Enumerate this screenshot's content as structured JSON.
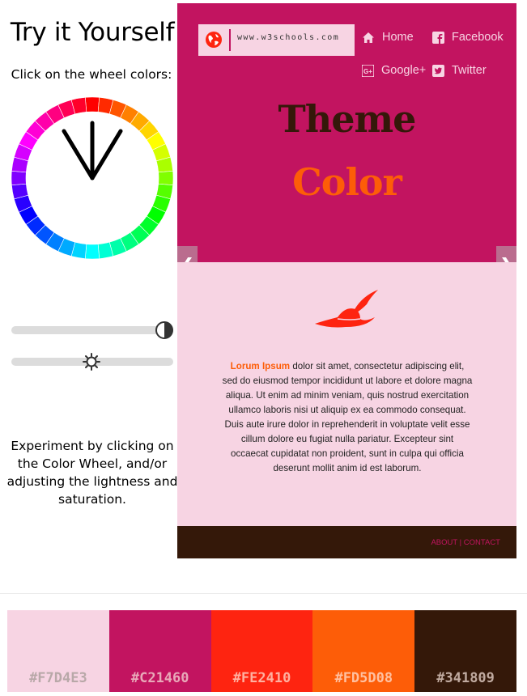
{
  "left": {
    "title": "Try it Yourself",
    "subtitle": "Click on the wheel colors:",
    "experiment_text": "Experiment by clicking on the Color Wheel, and/or adjusting the lightness and saturation.",
    "lightness_icon": "contrast-icon",
    "saturation_icon": "brightness-icon"
  },
  "preview": {
    "logo_text": "www.w3schools.com",
    "nav": {
      "home": "Home",
      "facebook": "Facebook",
      "googleplus": "Google+",
      "twitter": "Twitter"
    },
    "title_line1": "Theme",
    "title_line2": "Color",
    "prev_arrow": "❮",
    "next_arrow": "❯",
    "lorem_highlight": "Lorum Ipsum",
    "lorem_body": " dolor sit amet, consectetur adipiscing elit, sed do eiusmod tempor incididunt ut labore et dolore magna aliqua. Ut enim ad minim veniam, quis nostrud exercitation ullamco laboris nisi ut aliquip ex ea commodo consequat. Duis aute irure dolor in reprehenderit in voluptate velit esse cillum dolore eu fugiat nulla pariatur. Excepteur sint occaecat cupidatat non proident, sunt in culpa qui officia deserunt mollit anim id est laborum.",
    "footer_about": "ABOUT",
    "footer_sep": " | ",
    "footer_contact": "CONTACT"
  },
  "swatches": [
    {
      "label": "#F7D4E3",
      "color": "#F7D4E3"
    },
    {
      "label": "#C21460",
      "color": "#C21460"
    },
    {
      "label": "#FE2410",
      "color": "#FE2410"
    },
    {
      "label": "#FD5D08",
      "color": "#FD5D08"
    },
    {
      "label": "#341809",
      "color": "#341809"
    }
  ],
  "colors": {
    "primary": "#C21460",
    "light": "#F7D4E3",
    "red": "#FE2410",
    "orange": "#FD5D08",
    "dark": "#341809"
  }
}
